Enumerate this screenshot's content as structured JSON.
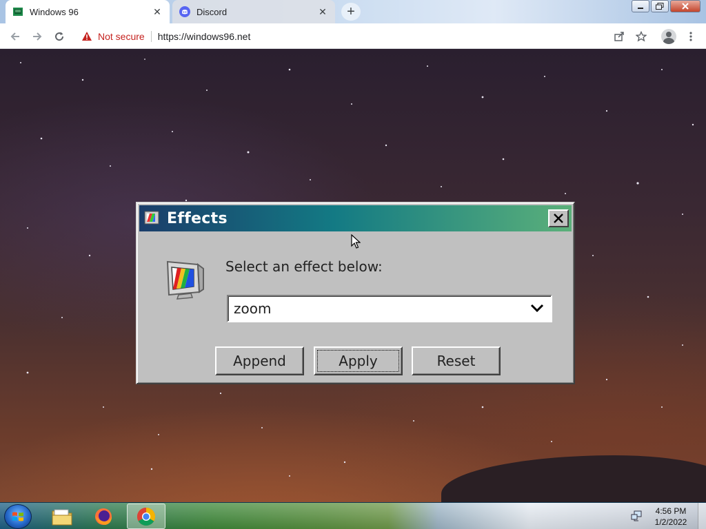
{
  "browser": {
    "tabs": [
      {
        "label": "Windows 96",
        "icon": "windows96-favicon"
      },
      {
        "label": "Discord",
        "icon": "discord-favicon"
      }
    ],
    "new_tab_symbol": "+",
    "close_symbol": "✕",
    "security_label": "Not secure",
    "url": "https://windows96.net"
  },
  "dialog": {
    "title": "Effects",
    "prompt": "Select an effect below:",
    "selected_effect": "zoom",
    "buttons": {
      "append": "Append",
      "apply": "Apply",
      "reset": "Reset"
    }
  },
  "taskbar": {
    "pinned": [
      "windows-explorer",
      "firefox",
      "chrome"
    ],
    "active_app": "chrome",
    "time": "4:56 PM",
    "date": "1/2/2022"
  },
  "colors": {
    "titlebar_start": "#1b3d6a",
    "titlebar_end": "#5bb07a",
    "not_secure": "#c5221f"
  }
}
